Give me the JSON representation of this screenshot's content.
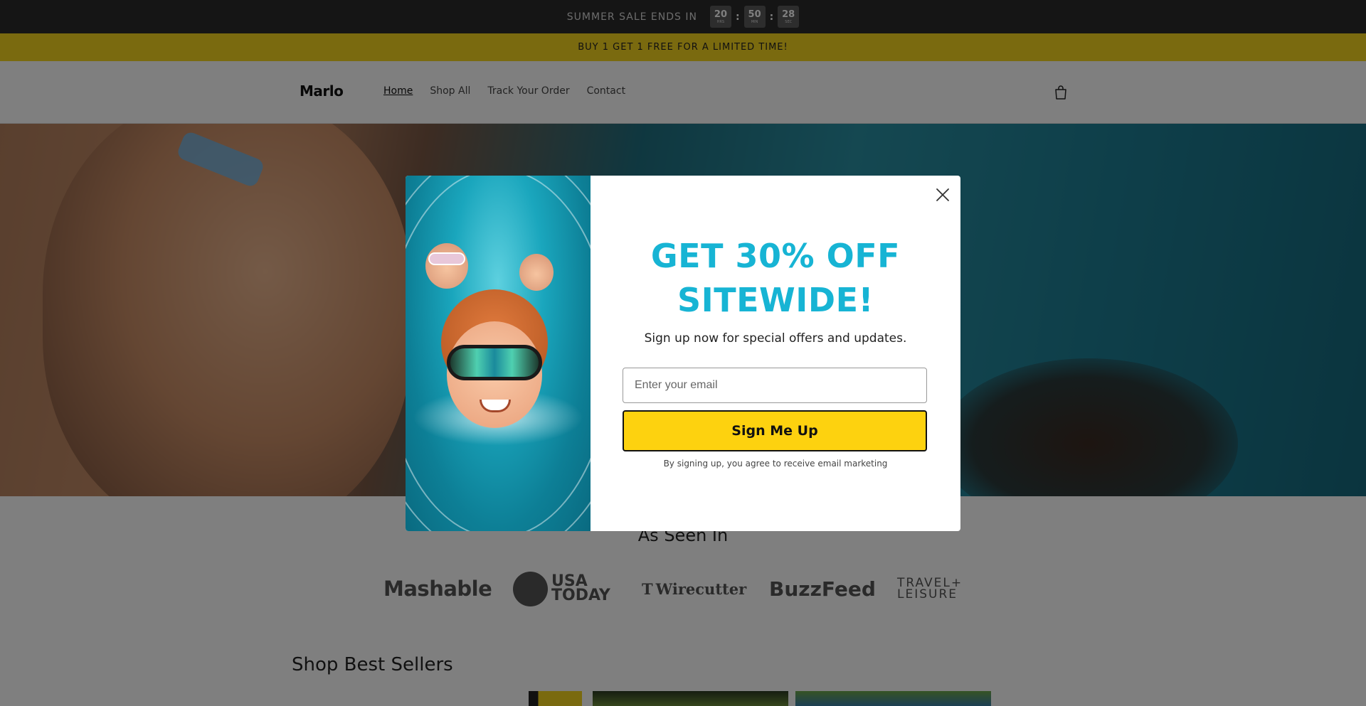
{
  "countdown": {
    "label": "SUMMER SALE ENDS IN",
    "hours": "20",
    "hours_unit": "HRS",
    "minutes": "50",
    "minutes_unit": "MIN",
    "seconds": "28",
    "seconds_unit": "SEC",
    "separator": ":"
  },
  "announcement": {
    "text": "BUY 1 GET 1 FREE FOR A LIMITED TIME!"
  },
  "header": {
    "logo": "Marlo",
    "nav": [
      {
        "label": "Home",
        "active": true
      },
      {
        "label": "Shop All"
      },
      {
        "label": "Track Your Order"
      },
      {
        "label": "Contact"
      }
    ],
    "cart_icon": "shopping-bag-icon"
  },
  "press": {
    "title": "As Seen In",
    "logos": [
      "Mashable",
      "USA TODAY",
      "Wirecutter",
      "BuzzFeed",
      "TRAVEL+ LEISURE"
    ],
    "usa_line1": "USA",
    "usa_line2": "TODAY",
    "wirecutter_mark": "T",
    "travel_line1": "TRAVEL+",
    "travel_line2": "LEISURE"
  },
  "best_sellers": {
    "title": "Shop Best Sellers"
  },
  "modal": {
    "headline_line1": "GET 30% OFF",
    "headline_line2": "SITEWIDE!",
    "subtext": "Sign up now for special offers and updates.",
    "email_placeholder": "Enter your email",
    "button_label": "Sign Me Up",
    "disclaimer": "By signing up, you agree to receive email marketing",
    "close_icon": "close-icon"
  },
  "colors": {
    "countdown_bg": "#2b2b2b",
    "announcement_bg": "#f4d41f",
    "headline": "#17b4d4",
    "button_bg": "#fdd20f"
  }
}
